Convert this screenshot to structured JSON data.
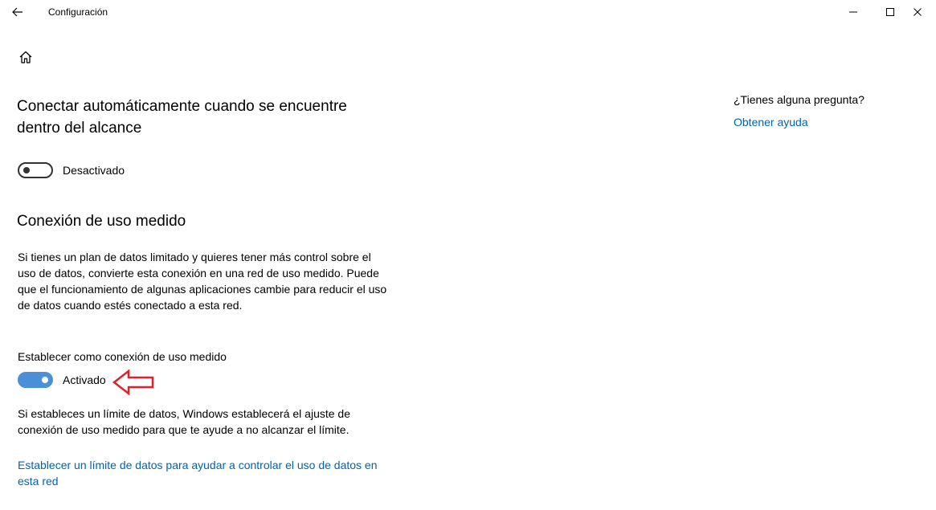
{
  "window": {
    "title": "Configuración"
  },
  "icons": {
    "back": "back-arrow-icon",
    "home": "home-icon",
    "minimize": "minimize-icon",
    "maximize": "maximize-icon",
    "close": "close-icon"
  },
  "auto_connect": {
    "title": "Conectar automáticamente cuando se encuentre dentro del alcance",
    "toggle_label": "Desactivado",
    "toggle_state": "off"
  },
  "metered": {
    "title": "Conexión de uso medido",
    "description": "Si tienes un plan de datos limitado y quieres tener más control sobre el uso de datos, convierte esta conexión en una red de uso medido. Puede que el funcionamiento de algunas aplicaciones cambie para reducir el uso de datos cuando estés conectado a esta red.",
    "setting_label": "Establecer como conexión de uso medido",
    "toggle_label": "Activado",
    "toggle_state": "on",
    "limit_note": "Si estableces un límite de datos, Windows establecerá el ajuste de conexión de uso medido para que te ayude a no alcanzar el límite.",
    "limit_link": "Establecer un límite de datos para ayudar a controlar el uso de datos en esta red"
  },
  "help": {
    "question": "¿Tienes alguna pregunta?",
    "link": "Obtener ayuda"
  },
  "colors": {
    "accent": "#0063b1",
    "toggle_on": "#4a90d9",
    "annotation_arrow": "#e0202a"
  }
}
